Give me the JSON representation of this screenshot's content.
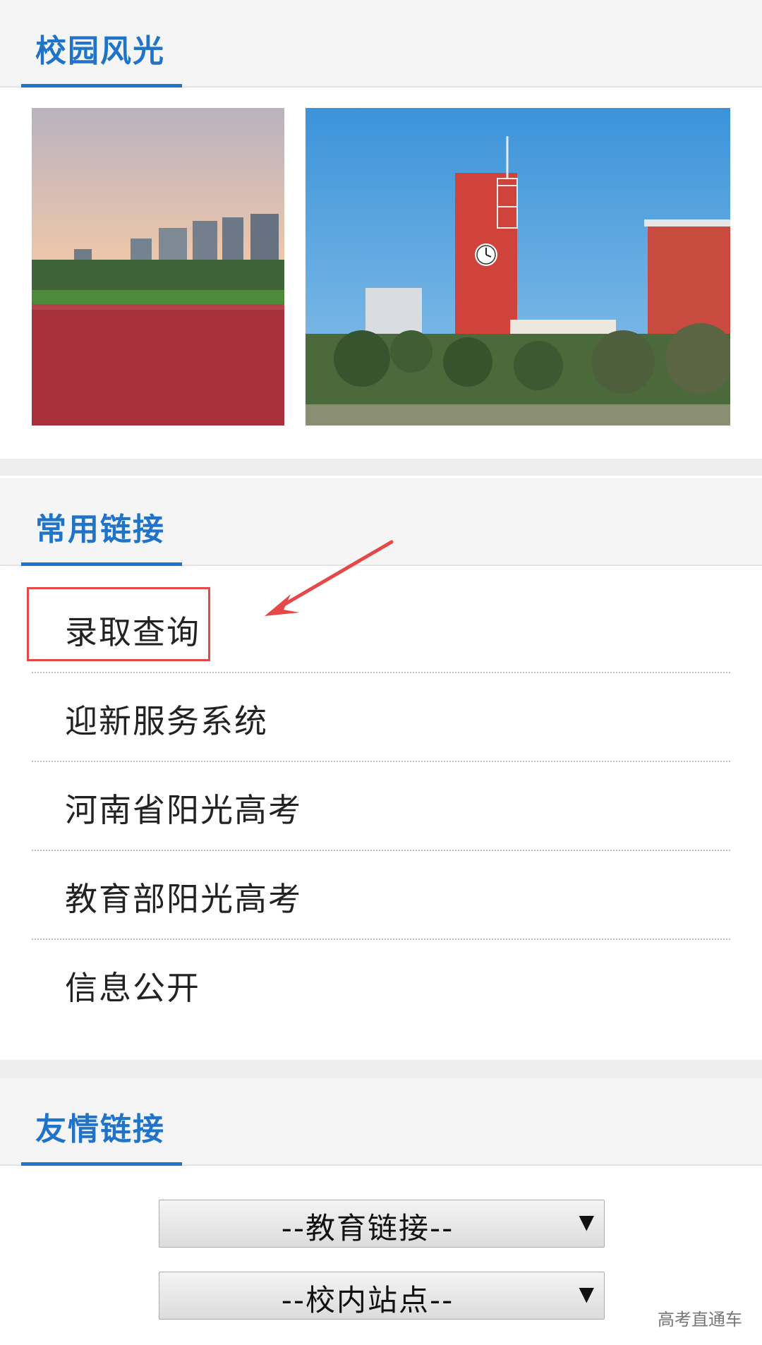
{
  "sections": {
    "campus_scenery": {
      "title": "校园风光"
    },
    "common_links": {
      "title": "常用链接",
      "items": [
        {
          "label": "录取查询"
        },
        {
          "label": "迎新服务系统"
        },
        {
          "label": "河南省阳光高考"
        },
        {
          "label": "教育部阳光高考"
        },
        {
          "label": "信息公开"
        }
      ]
    },
    "friend_links": {
      "title": "友情链接",
      "selects": [
        {
          "value": "--教育链接--"
        },
        {
          "value": "--校内站点--"
        }
      ]
    }
  },
  "annotation": {
    "color": "#e54848"
  },
  "watermark": "高考直通车",
  "colors": {
    "accent": "#1f74c9",
    "header_bg": "#f5f5f5"
  }
}
